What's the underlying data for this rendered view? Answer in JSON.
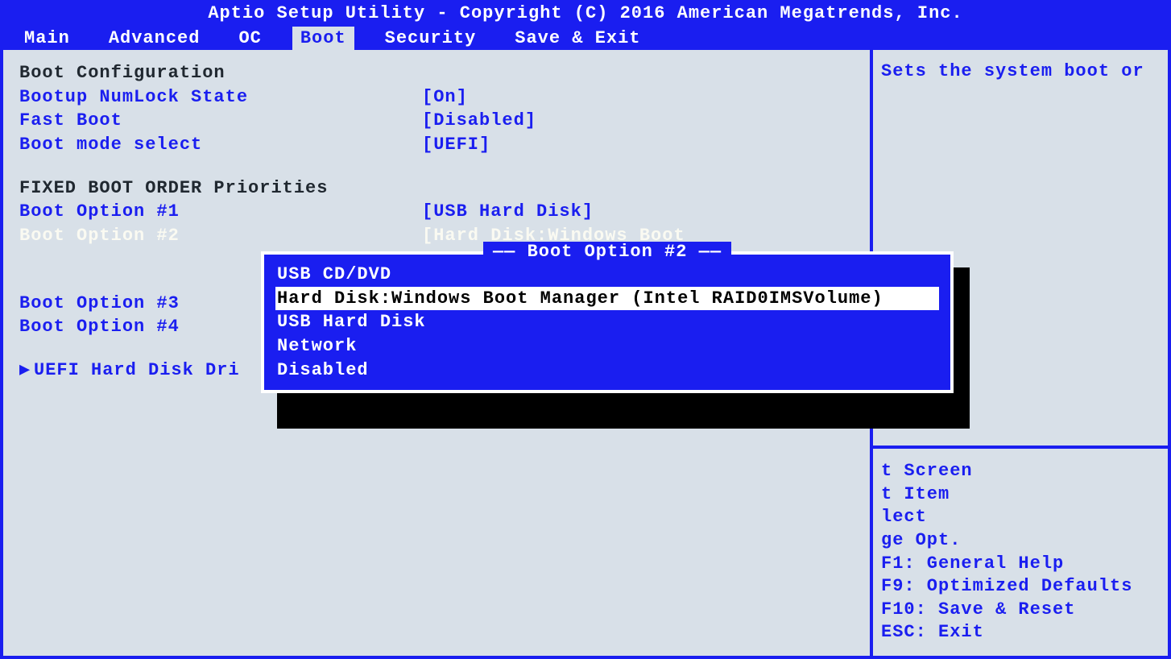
{
  "header": {
    "title": "Aptio Setup Utility - Copyright (C) 2016 American Megatrends, Inc."
  },
  "tabs": [
    "Main",
    "Advanced",
    "OC",
    "Boot",
    "Security",
    "Save & Exit"
  ],
  "active_tab": "Boot",
  "main": {
    "section1_title": "Boot Configuration",
    "settings": [
      {
        "label": "Bootup NumLock State",
        "value": "[On]"
      },
      {
        "label": "Fast Boot",
        "value": "[Disabled]"
      },
      {
        "label": "Boot mode select",
        "value": "[UEFI]"
      }
    ],
    "section2_title": "FIXED BOOT ORDER Priorities",
    "boot_opts": [
      {
        "label": "Boot Option #1",
        "value": "[USB Hard Disk]",
        "selected": false
      },
      {
        "label": "Boot Option #2",
        "value": "[Hard Disk:Windows Boot",
        "value2": "Manager (Intel",
        "selected": true
      },
      {
        "label": "Boot Option #3",
        "value": "",
        "selected": false
      },
      {
        "label": "Boot Option #4",
        "value": "",
        "selected": false
      }
    ],
    "submenu": "UEFI Hard Disk Dri"
  },
  "side": {
    "help": "Sets the system boot or",
    "keys": [
      "t Screen",
      "t Item",
      "lect",
      "ge Opt.",
      "F1: General Help",
      "F9: Optimized Defaults",
      "F10: Save & Reset",
      "ESC: Exit"
    ]
  },
  "popup": {
    "title": "Boot Option #2",
    "items": [
      {
        "text": "USB CD/DVD",
        "highlight": false
      },
      {
        "text": "Hard Disk:Windows Boot Manager (Intel RAID0IMSVolume)",
        "highlight": true
      },
      {
        "text": "USB Hard Disk",
        "highlight": false
      },
      {
        "text": "Network",
        "highlight": false
      },
      {
        "text": "Disabled",
        "highlight": false
      }
    ]
  }
}
